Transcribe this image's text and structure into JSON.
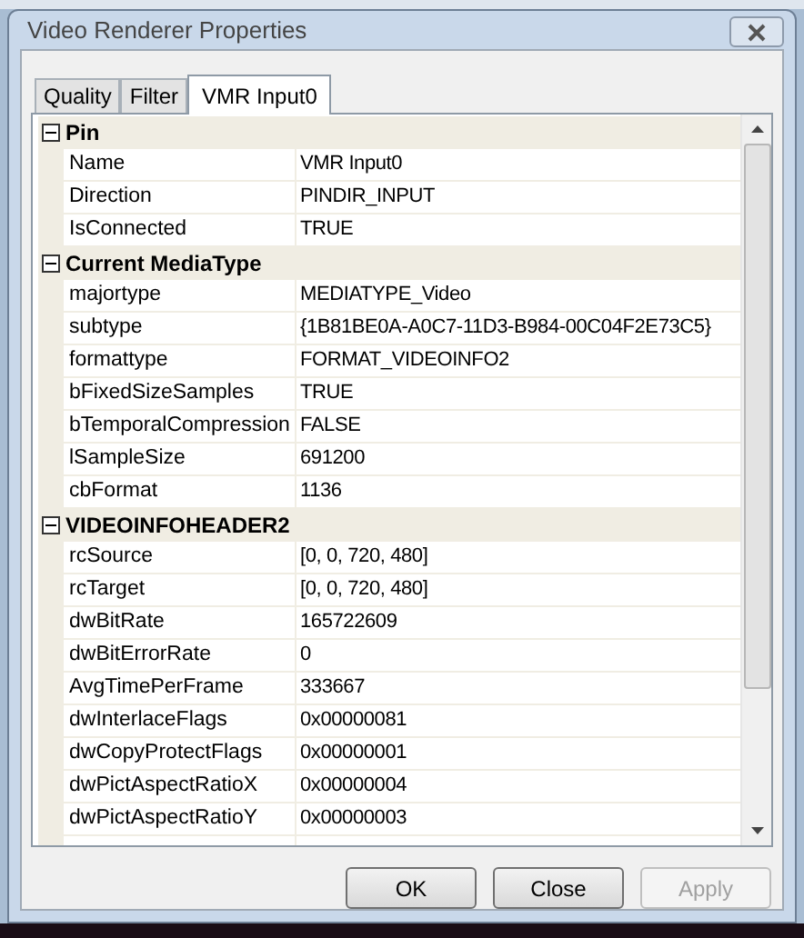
{
  "window": {
    "title": "Video Renderer Properties"
  },
  "tabs": [
    {
      "label": "Quality",
      "selected": false
    },
    {
      "label": "Filter",
      "selected": false
    },
    {
      "label": "VMR Input0",
      "selected": true
    }
  ],
  "groups": [
    {
      "title": "Pin",
      "expanded": true,
      "rows": [
        {
          "name": "Name",
          "value": "VMR Input0"
        },
        {
          "name": "Direction",
          "value": "PINDIR_INPUT"
        },
        {
          "name": "IsConnected",
          "value": "TRUE"
        }
      ]
    },
    {
      "title": "Current MediaType",
      "expanded": true,
      "rows": [
        {
          "name": "majortype",
          "value": "MEDIATYPE_Video"
        },
        {
          "name": "subtype",
          "value": "{1B81BE0A-A0C7-11D3-B984-00C04F2E73C5}"
        },
        {
          "name": "formattype",
          "value": "FORMAT_VIDEOINFO2"
        },
        {
          "name": "bFixedSizeSamples",
          "value": "TRUE"
        },
        {
          "name": "bTemporalCompression",
          "value": "FALSE"
        },
        {
          "name": "lSampleSize",
          "value": "691200"
        },
        {
          "name": "cbFormat",
          "value": "1136"
        }
      ]
    },
    {
      "title": "VIDEOINFOHEADER2",
      "expanded": true,
      "rows": [
        {
          "name": "rcSource",
          "value": "[0, 0, 720, 480]"
        },
        {
          "name": "rcTarget",
          "value": "[0, 0, 720, 480]"
        },
        {
          "name": "dwBitRate",
          "value": "165722609"
        },
        {
          "name": "dwBitErrorRate",
          "value": "0"
        },
        {
          "name": "AvgTimePerFrame",
          "value": "333667"
        },
        {
          "name": "dwInterlaceFlags",
          "value": "0x00000081"
        },
        {
          "name": "dwCopyProtectFlags",
          "value": "0x00000001"
        },
        {
          "name": "dwPictAspectRatioX",
          "value": "0x00000004"
        },
        {
          "name": "dwPictAspectRatioY",
          "value": "0x00000003"
        }
      ]
    }
  ],
  "buttons": [
    {
      "label": "OK",
      "disabled": false
    },
    {
      "label": "Close",
      "disabled": false
    },
    {
      "label": "Apply",
      "disabled": true
    }
  ]
}
